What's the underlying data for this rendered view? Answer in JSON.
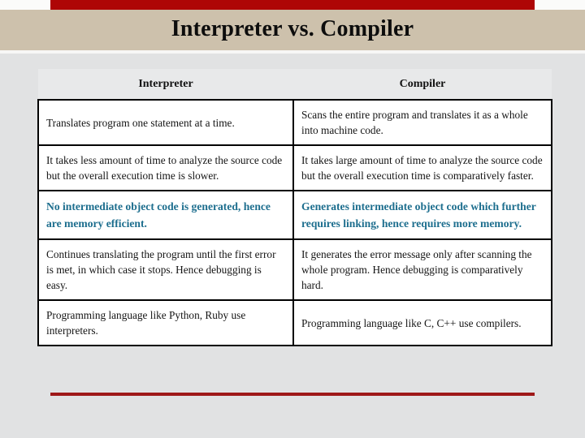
{
  "slide": {
    "title": "Interpreter vs. Compiler",
    "accent_red": "#ae0606",
    "band_tan": "#cdc1ac",
    "background": "#e1e2e3",
    "highlight_text_color": "#1d6e8e",
    "bottom_rule_color": "#9e1818"
  },
  "table": {
    "headers": [
      "Interpreter",
      "Compiler"
    ],
    "rows": [
      {
        "highlight": false,
        "interpreter": "Translates program one statement at a time.",
        "compiler": "Scans the entire program and translates it as a whole into machine code."
      },
      {
        "highlight": false,
        "interpreter": "It takes less amount of time to analyze the source code but the overall execution time is slower.",
        "compiler": "It takes large amount of time to analyze the source code but the overall execution time is comparatively faster."
      },
      {
        "highlight": true,
        "interpreter": "No intermediate object code is generated, hence are memory efficient.",
        "compiler": "Generates intermediate object code which further requires linking, hence requires more memory."
      },
      {
        "highlight": false,
        "interpreter": "Continues translating the program until the first error is met, in which case it stops. Hence debugging is easy.",
        "compiler": "It generates the error message only after scanning the whole program. Hence debugging is comparatively hard."
      },
      {
        "highlight": false,
        "interpreter": "Programming language like Python, Ruby use interpreters.",
        "compiler": "Programming language like C, C++ use compilers."
      }
    ]
  }
}
